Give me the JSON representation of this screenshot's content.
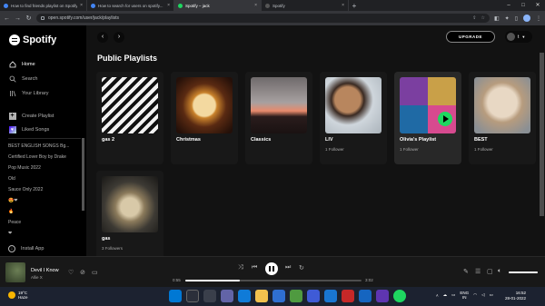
{
  "browser": {
    "tabs": [
      {
        "title": "How to find friends playlist on Spotify...",
        "active": false
      },
      {
        "title": "How to search for users on spotify...",
        "active": false
      },
      {
        "title": "Spotify – jack",
        "active": true
      },
      {
        "title": "Spotify",
        "active": false
      }
    ],
    "url": "open.spotify.com/user/jack/playlists"
  },
  "sidebar": {
    "logo": "Spotify",
    "nav": [
      {
        "label": "Home",
        "icon": "home-icon"
      },
      {
        "label": "Search",
        "icon": "search-icon"
      },
      {
        "label": "Your Library",
        "icon": "library-icon"
      }
    ],
    "actions": [
      {
        "label": "Create Playlist",
        "icon": "plus-icon"
      },
      {
        "label": "Liked Songs",
        "icon": "heart-icon"
      }
    ],
    "playlists": [
      "BEST ENGLISH SONGS Bg...",
      "Certified Lover Boy by Drake",
      "Pop Music 2022",
      "Old",
      "Sauce Only 2022",
      "😍❤",
      "🔥",
      "Peace",
      "❤"
    ],
    "install": "Install App"
  },
  "main": {
    "upgrade": "UPGRADE",
    "user_initial": "t",
    "heading": "Public Playlists",
    "cards": [
      {
        "title": "gas 2",
        "sub": ""
      },
      {
        "title": "Christmas",
        "sub": ""
      },
      {
        "title": "Classics",
        "sub": ""
      },
      {
        "title": "LIV",
        "sub": "1 Follower"
      },
      {
        "title": "Olivia's Playlist",
        "sub": "1 Follower"
      },
      {
        "title": "BEST",
        "sub": "1 Follower"
      },
      {
        "title": "gas",
        "sub": "3 Followers"
      }
    ]
  },
  "player": {
    "song": "Devil I Know",
    "artist": "Allie X",
    "elapsed": "0:55",
    "duration": "3:02",
    "progress": 0.31,
    "volume": 1.0
  },
  "taskbar": {
    "temp": "19°C",
    "weather": "Haze",
    "lang_top": "ENG",
    "lang_bottom": "IN",
    "time": "16:52",
    "date": "28-01-2022"
  },
  "colors": {
    "accent": "#1ed760",
    "main_bg": "#121212",
    "sidebar_bg": "#000000"
  }
}
